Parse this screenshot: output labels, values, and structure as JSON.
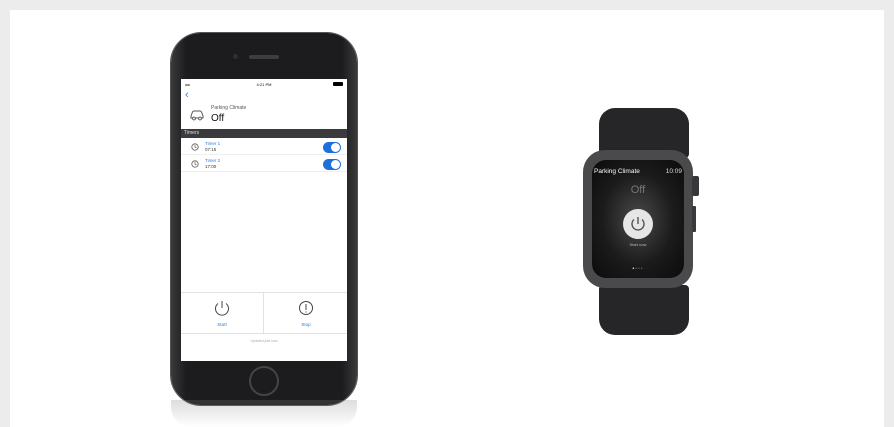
{
  "phone": {
    "status_bar": {
      "signal": "••••• ",
      "time": "4:21 PM"
    },
    "back_icon": "chevron-left-icon",
    "parking_climate": {
      "title": "Parking Climate",
      "value": "Off"
    },
    "timers_section_label": "Timers",
    "timers": [
      {
        "name": "Timer 1",
        "time": "07:15",
        "enabled": true
      },
      {
        "name": "Timer 2",
        "time": "17:00",
        "enabled": true
      }
    ],
    "actions": {
      "start_label": "Start",
      "stop_label": "Stop"
    },
    "update_text": "Updated just now",
    "accent_color": "#2a7bdc"
  },
  "watch": {
    "title": "Parking Climate",
    "time": "10:09",
    "status": "Off",
    "start_label": "Start now",
    "page_dots": {
      "count": 4,
      "active": 1
    }
  }
}
